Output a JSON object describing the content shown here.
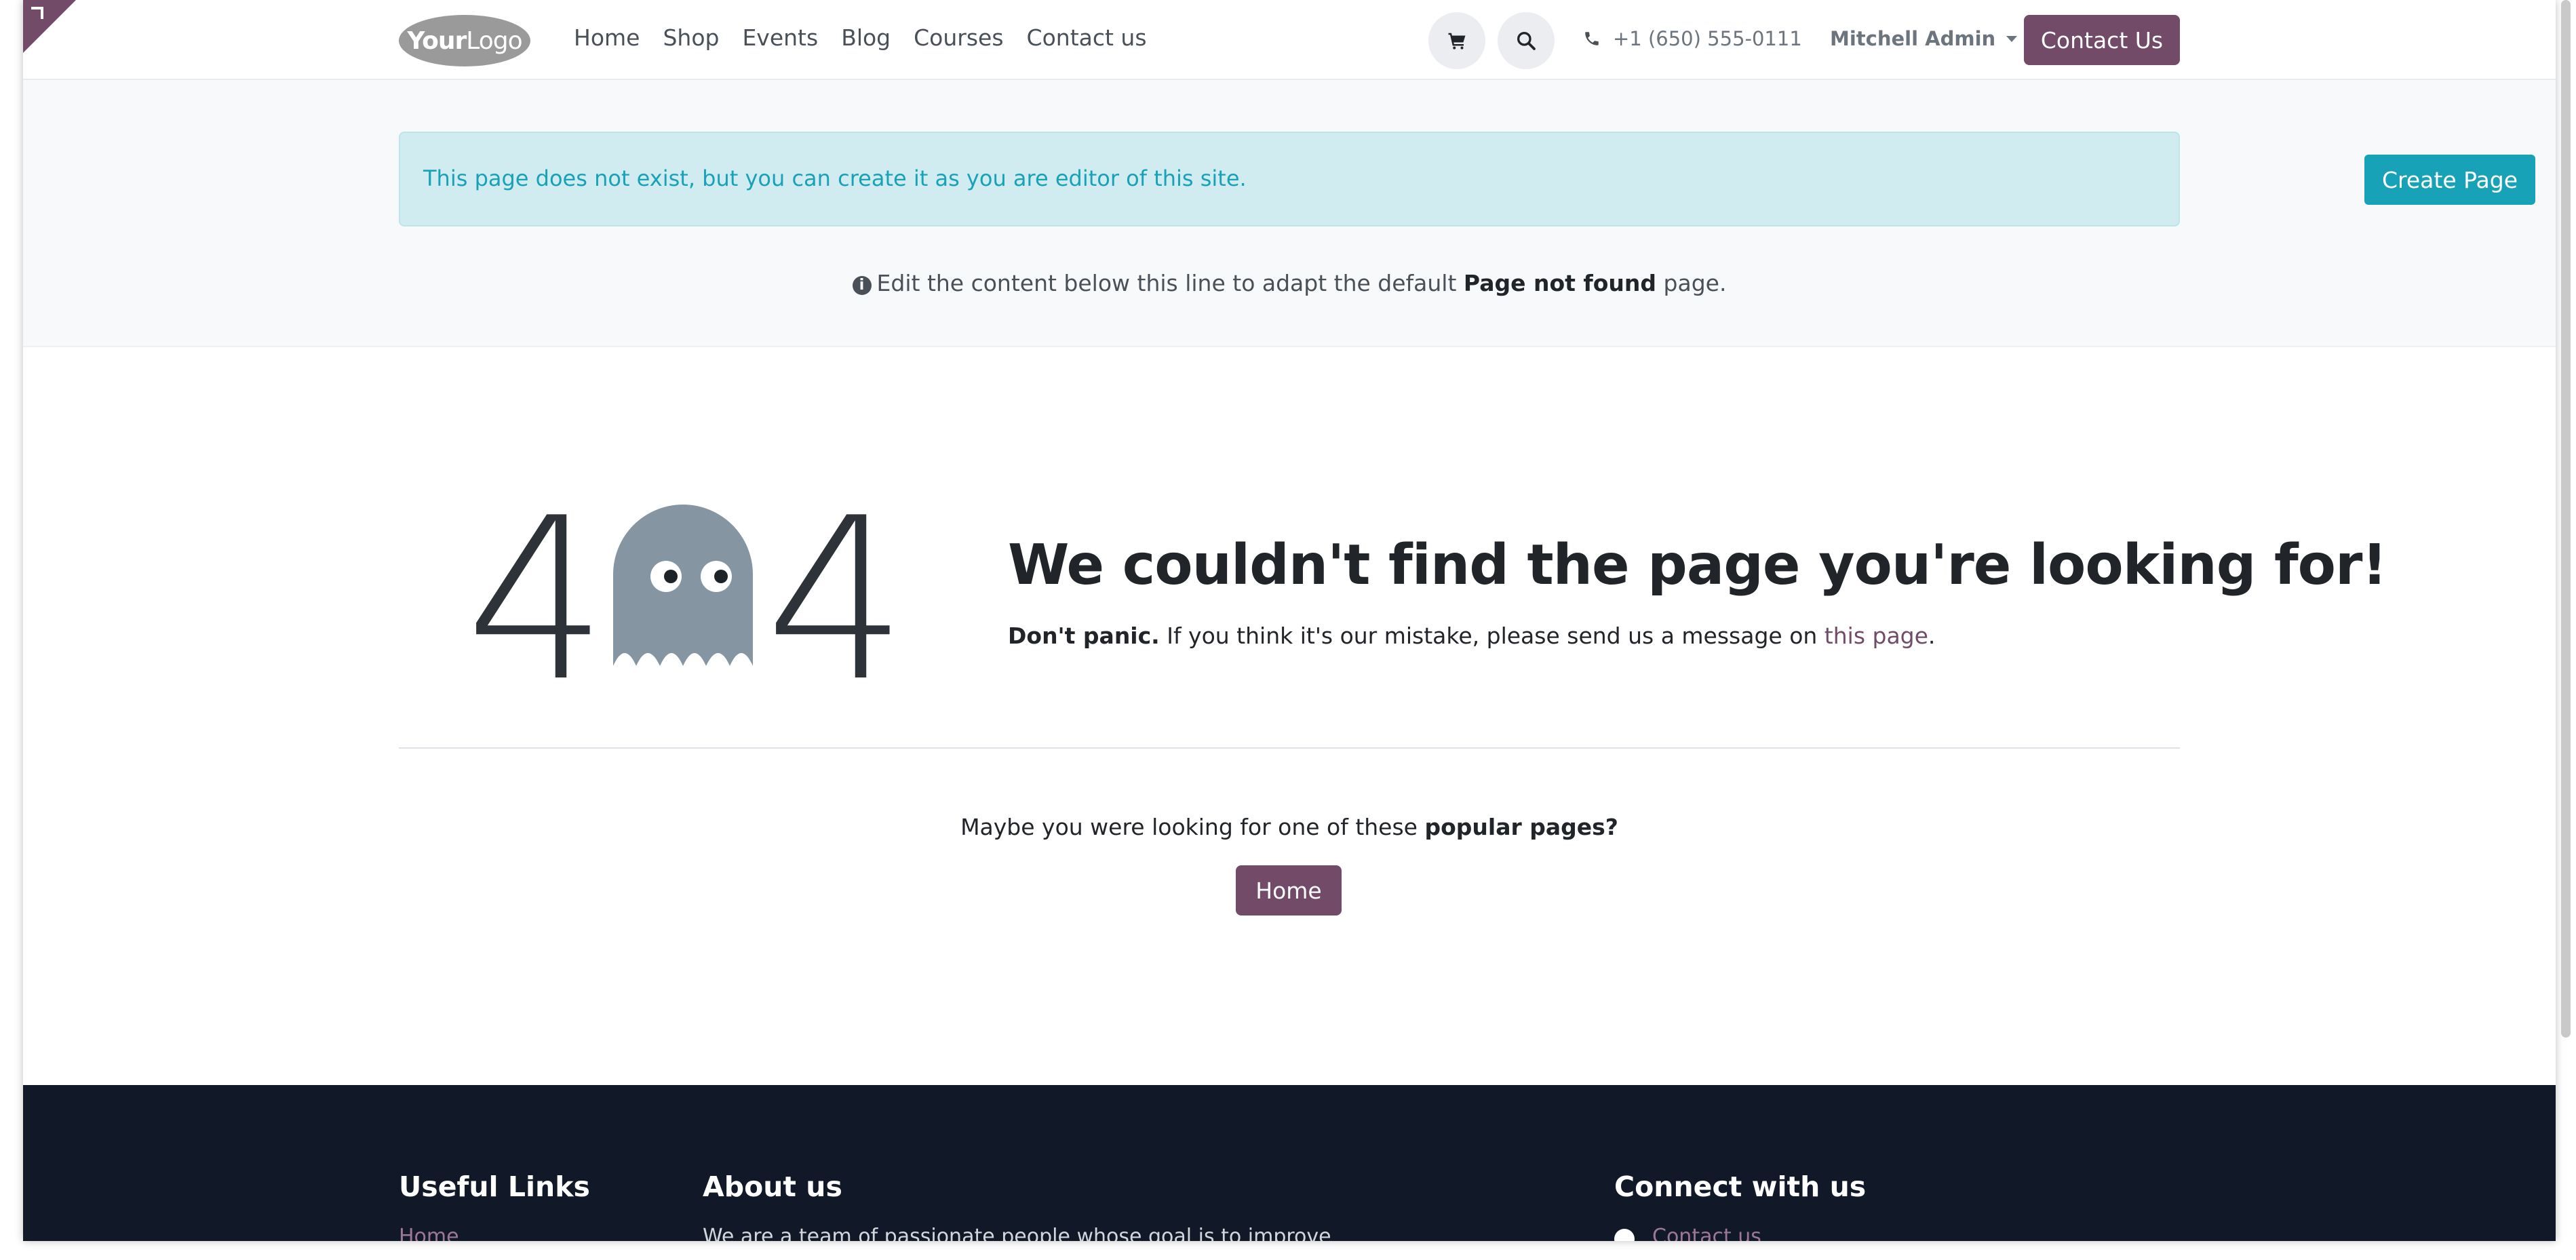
{
  "header": {
    "logo_bold": "Your",
    "logo_thin": "Logo",
    "nav": [
      "Home",
      "Shop",
      "Events",
      "Blog",
      "Courses",
      "Contact us"
    ],
    "phone": "+1 (650) 555-0111",
    "user": "Mitchell Admin",
    "contact_button": "Contact Us",
    "icons": [
      "cart-icon",
      "search-icon",
      "phone-icon"
    ]
  },
  "editor": {
    "alert_text": "This page does not exist, but you can create it as you are editor of this site.",
    "create_button": "Create Page",
    "note_prefix": "Edit the content below this line to adapt the default ",
    "note_bold": "Page not found",
    "note_suffix": " page."
  },
  "error": {
    "digit_left": "4",
    "digit_right": "4",
    "headline": "We couldn't find the page you're looking for!",
    "sub_bold": "Don't panic.",
    "sub_text": " If you think it's our mistake, please send us a message on ",
    "sub_link": "this page",
    "sub_end": "."
  },
  "popular": {
    "prefix": "Maybe you were looking for one of these ",
    "bold": "popular pages?",
    "home_button": "Home"
  },
  "footer": {
    "useful_links": "Useful Links",
    "useful_first": "Home",
    "about": "About us",
    "about_text": "We are a team of passionate people whose goal is to improve",
    "connect": "Connect with us",
    "connect_first": "Contact us"
  },
  "colors": {
    "brand": "#714b67",
    "info": "#17a2b8",
    "footer_bg": "#111827",
    "ghost": "#8595a2"
  }
}
